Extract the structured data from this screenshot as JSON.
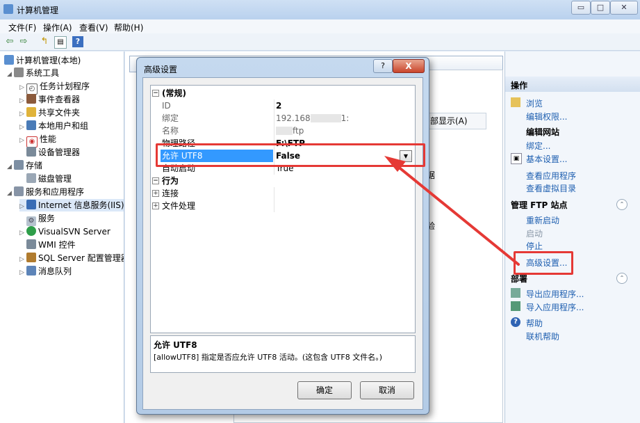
{
  "window": {
    "title": "计算机管理",
    "buttons": {
      "minimize": "▭",
      "maximize": "□",
      "close": "✕"
    }
  },
  "menu": [
    "文件(F)",
    "操作(A)",
    "查看(V)",
    "帮助(H)"
  ],
  "tree": {
    "root": "计算机管理(本地)",
    "system_tools": "系统工具",
    "task_scheduler": "任务计划程序",
    "event_viewer": "事件查看器",
    "shared_folders": "共享文件夹",
    "local_users": "本地用户和组",
    "performance": "性能",
    "device_manager": "设备管理器",
    "storage": "存储",
    "disk_management": "磁盘管理",
    "services_apps": "服务和应用程序",
    "iis": "Internet 信息服务(IIS)管",
    "services": "服务",
    "visualsvn": "VisualSVN Server",
    "wmi": "WMI 控件",
    "sql_server": "SQL Server 配置管理器",
    "message_queue": "消息队列"
  },
  "middle": {
    "column_header": "部显示(A)",
    "fragment1": "据",
    "fragment2": "验"
  },
  "actions": {
    "header": "操作",
    "browse": "浏览",
    "edit_permissions": "编辑权限...",
    "edit_site": "编辑网站",
    "bindings": "绑定...",
    "basic_settings": "基本设置...",
    "view_apps": "查看应用程序",
    "view_vdirs": "查看虚拟目录",
    "manage_ftp": "管理 FTP 站点",
    "restart": "重新启动",
    "start": "启动",
    "stop": "停止",
    "advanced_settings": "高级设置...",
    "deploy": "部署",
    "export_app": "导出应用程序...",
    "import_app": "导入应用程序...",
    "help": "帮助",
    "online_help": "联机帮助"
  },
  "dialog": {
    "title": "高级设置",
    "help_button": "?",
    "close_button": "X",
    "properties": {
      "general_category": "(常规)",
      "id_name": "ID",
      "id_value": "2",
      "binding_name": "绑定",
      "binding_value": "192.168",
      "binding_suffix": "1:",
      "name_name": "名称",
      "name_value": "ftp",
      "path_name": "物理路径",
      "path_value": "F:\\FTP",
      "utf8_name": "允许 UTF8",
      "utf8_value": "False",
      "autostart_name": "自动启动",
      "autostart_value": "True",
      "behavior_category": "行为",
      "connection": "连接",
      "file_handling": "文件处理"
    },
    "description": {
      "title": "允许 UTF8",
      "text": "[allowUTF8] 指定是否应允许 UTF8 活动。(这包含 UTF8 文件名。)"
    },
    "ok": "确定",
    "cancel": "取消"
  },
  "colors": {
    "selection": "#3399ff",
    "link": "#1e5fb0",
    "annotation_red": "#e53935"
  }
}
